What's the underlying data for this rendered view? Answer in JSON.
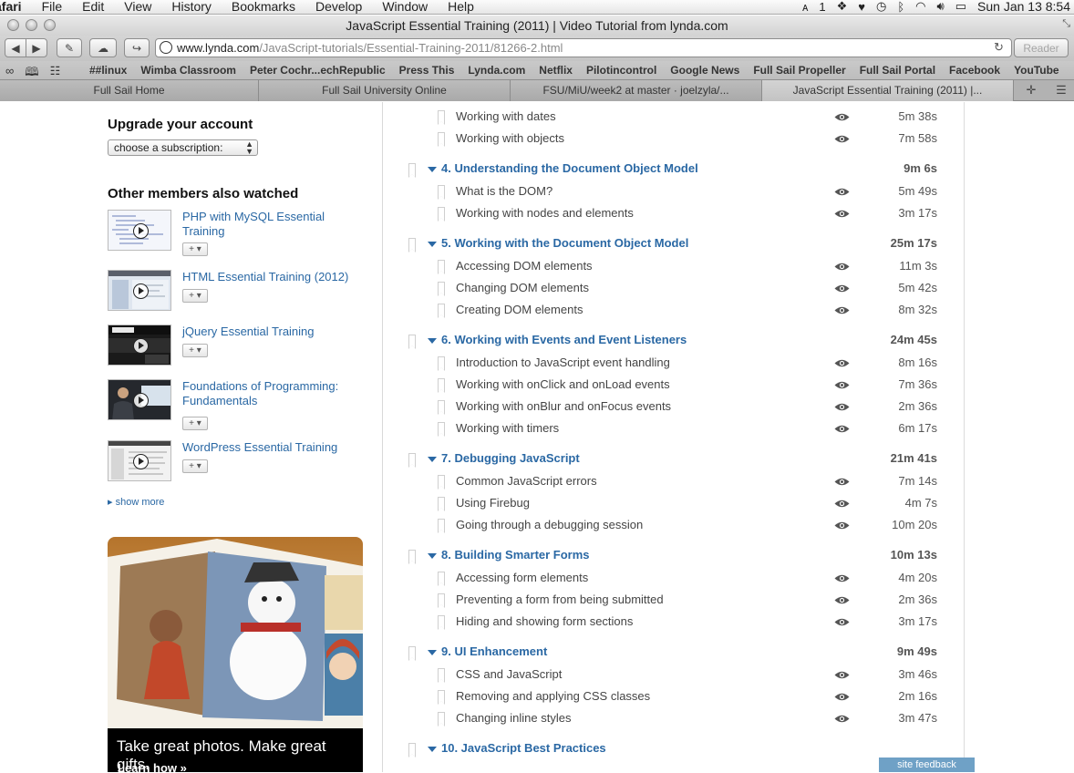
{
  "menubar": {
    "app_name": "afari",
    "items": [
      "File",
      "Edit",
      "View",
      "History",
      "Bookmarks",
      "Develop",
      "Window",
      "Help"
    ],
    "tray": {
      "badge": "1",
      "clock": "Sun Jan 13  8:54"
    }
  },
  "window": {
    "title": "JavaScript Essential Training (2011) | Video Tutorial from lynda.com"
  },
  "toolbar": {
    "url_domain": "www.lynda.com",
    "url_path": "/JavaScript-tutorials/Essential-Training-2011/81266-2.html",
    "reader_label": "Reader"
  },
  "bookmarks": [
    "##linux",
    "Wimba Classroom",
    "Peter Cochr...echRepublic",
    "Press This",
    "Lynda.com",
    "Netflix",
    "Pilotincontrol",
    "Google News",
    "Full Sail Propeller",
    "Full Sail Portal",
    "Facebook",
    "YouTube"
  ],
  "tabs": [
    "Full Sail Home",
    "Full Sail University Online",
    "FSU/MiU/week2 at master · joelzyla/...",
    "JavaScript Essential Training (2011) |..."
  ],
  "sidebar": {
    "upgrade_heading": "Upgrade your account",
    "subscription_select": "choose a subscription:",
    "watched_heading": "Other members also watched",
    "courses": [
      {
        "title": "PHP with MySQL Essential Training",
        "add": "+ ▾"
      },
      {
        "title": "HTML Essential Training (2012)",
        "add": "+ ▾"
      },
      {
        "title": "jQuery Essential Training",
        "add": "+ ▾"
      },
      {
        "title": "Foundations of Programming: Fundamentals",
        "add": "+ ▾"
      },
      {
        "title": "WordPress Essential Training",
        "add": "+ ▾"
      }
    ],
    "show_more": "show more",
    "promo": {
      "caption": "Take great photos. Make great gifts.",
      "learn": "Learn how »"
    }
  },
  "toc": {
    "rows": [
      {
        "kind": "lesson",
        "title": "Working with dates",
        "duration": "5m 38s"
      },
      {
        "kind": "lesson",
        "title": "Working with objects",
        "duration": "7m 58s"
      },
      {
        "kind": "chapter",
        "title": "4. Understanding the Document Object Model",
        "duration": "9m 6s"
      },
      {
        "kind": "lesson",
        "title": "What is the DOM?",
        "duration": "5m 49s"
      },
      {
        "kind": "lesson",
        "title": "Working with nodes and elements",
        "duration": "3m 17s"
      },
      {
        "kind": "chapter",
        "title": "5. Working with the Document Object Model",
        "duration": "25m 17s"
      },
      {
        "kind": "lesson",
        "title": "Accessing DOM elements",
        "duration": "11m 3s"
      },
      {
        "kind": "lesson",
        "title": "Changing DOM elements",
        "duration": "5m 42s"
      },
      {
        "kind": "lesson",
        "title": "Creating DOM elements",
        "duration": "8m 32s"
      },
      {
        "kind": "chapter",
        "title": "6. Working with Events and Event Listeners",
        "duration": "24m 45s"
      },
      {
        "kind": "lesson",
        "title": "Introduction to JavaScript event handling",
        "duration": "8m 16s"
      },
      {
        "kind": "lesson",
        "title": "Working with onClick and onLoad events",
        "duration": "7m 36s"
      },
      {
        "kind": "lesson",
        "title": "Working with onBlur and onFocus events",
        "duration": "2m 36s"
      },
      {
        "kind": "lesson",
        "title": "Working with timers",
        "duration": "6m 17s"
      },
      {
        "kind": "chapter",
        "title": "7. Debugging JavaScript",
        "duration": "21m 41s"
      },
      {
        "kind": "lesson",
        "title": "Common JavaScript errors",
        "duration": "7m 14s"
      },
      {
        "kind": "lesson",
        "title": "Using Firebug",
        "duration": "4m 7s"
      },
      {
        "kind": "lesson",
        "title": "Going through a debugging session",
        "duration": "10m 20s"
      },
      {
        "kind": "chapter",
        "title": "8. Building Smarter Forms",
        "duration": "10m 13s"
      },
      {
        "kind": "lesson",
        "title": "Accessing form elements",
        "duration": "4m 20s"
      },
      {
        "kind": "lesson",
        "title": "Preventing a form from being submitted",
        "duration": "2m 36s"
      },
      {
        "kind": "lesson",
        "title": "Hiding and showing form sections",
        "duration": "3m 17s"
      },
      {
        "kind": "chapter",
        "title": "9. UI Enhancement",
        "duration": "9m 49s"
      },
      {
        "kind": "lesson",
        "title": "CSS and JavaScript",
        "duration": "3m 46s"
      },
      {
        "kind": "lesson",
        "title": "Removing and applying CSS classes",
        "duration": "2m 16s"
      },
      {
        "kind": "lesson",
        "title": "Changing inline styles",
        "duration": "3m 47s"
      },
      {
        "kind": "chapter",
        "title": "10. JavaScript Best Practices",
        "duration": ""
      }
    ]
  },
  "feedback_label": "site feedback",
  "colors": {
    "link": "#2a68a4",
    "feedback_bg": "#6fa1c6"
  }
}
